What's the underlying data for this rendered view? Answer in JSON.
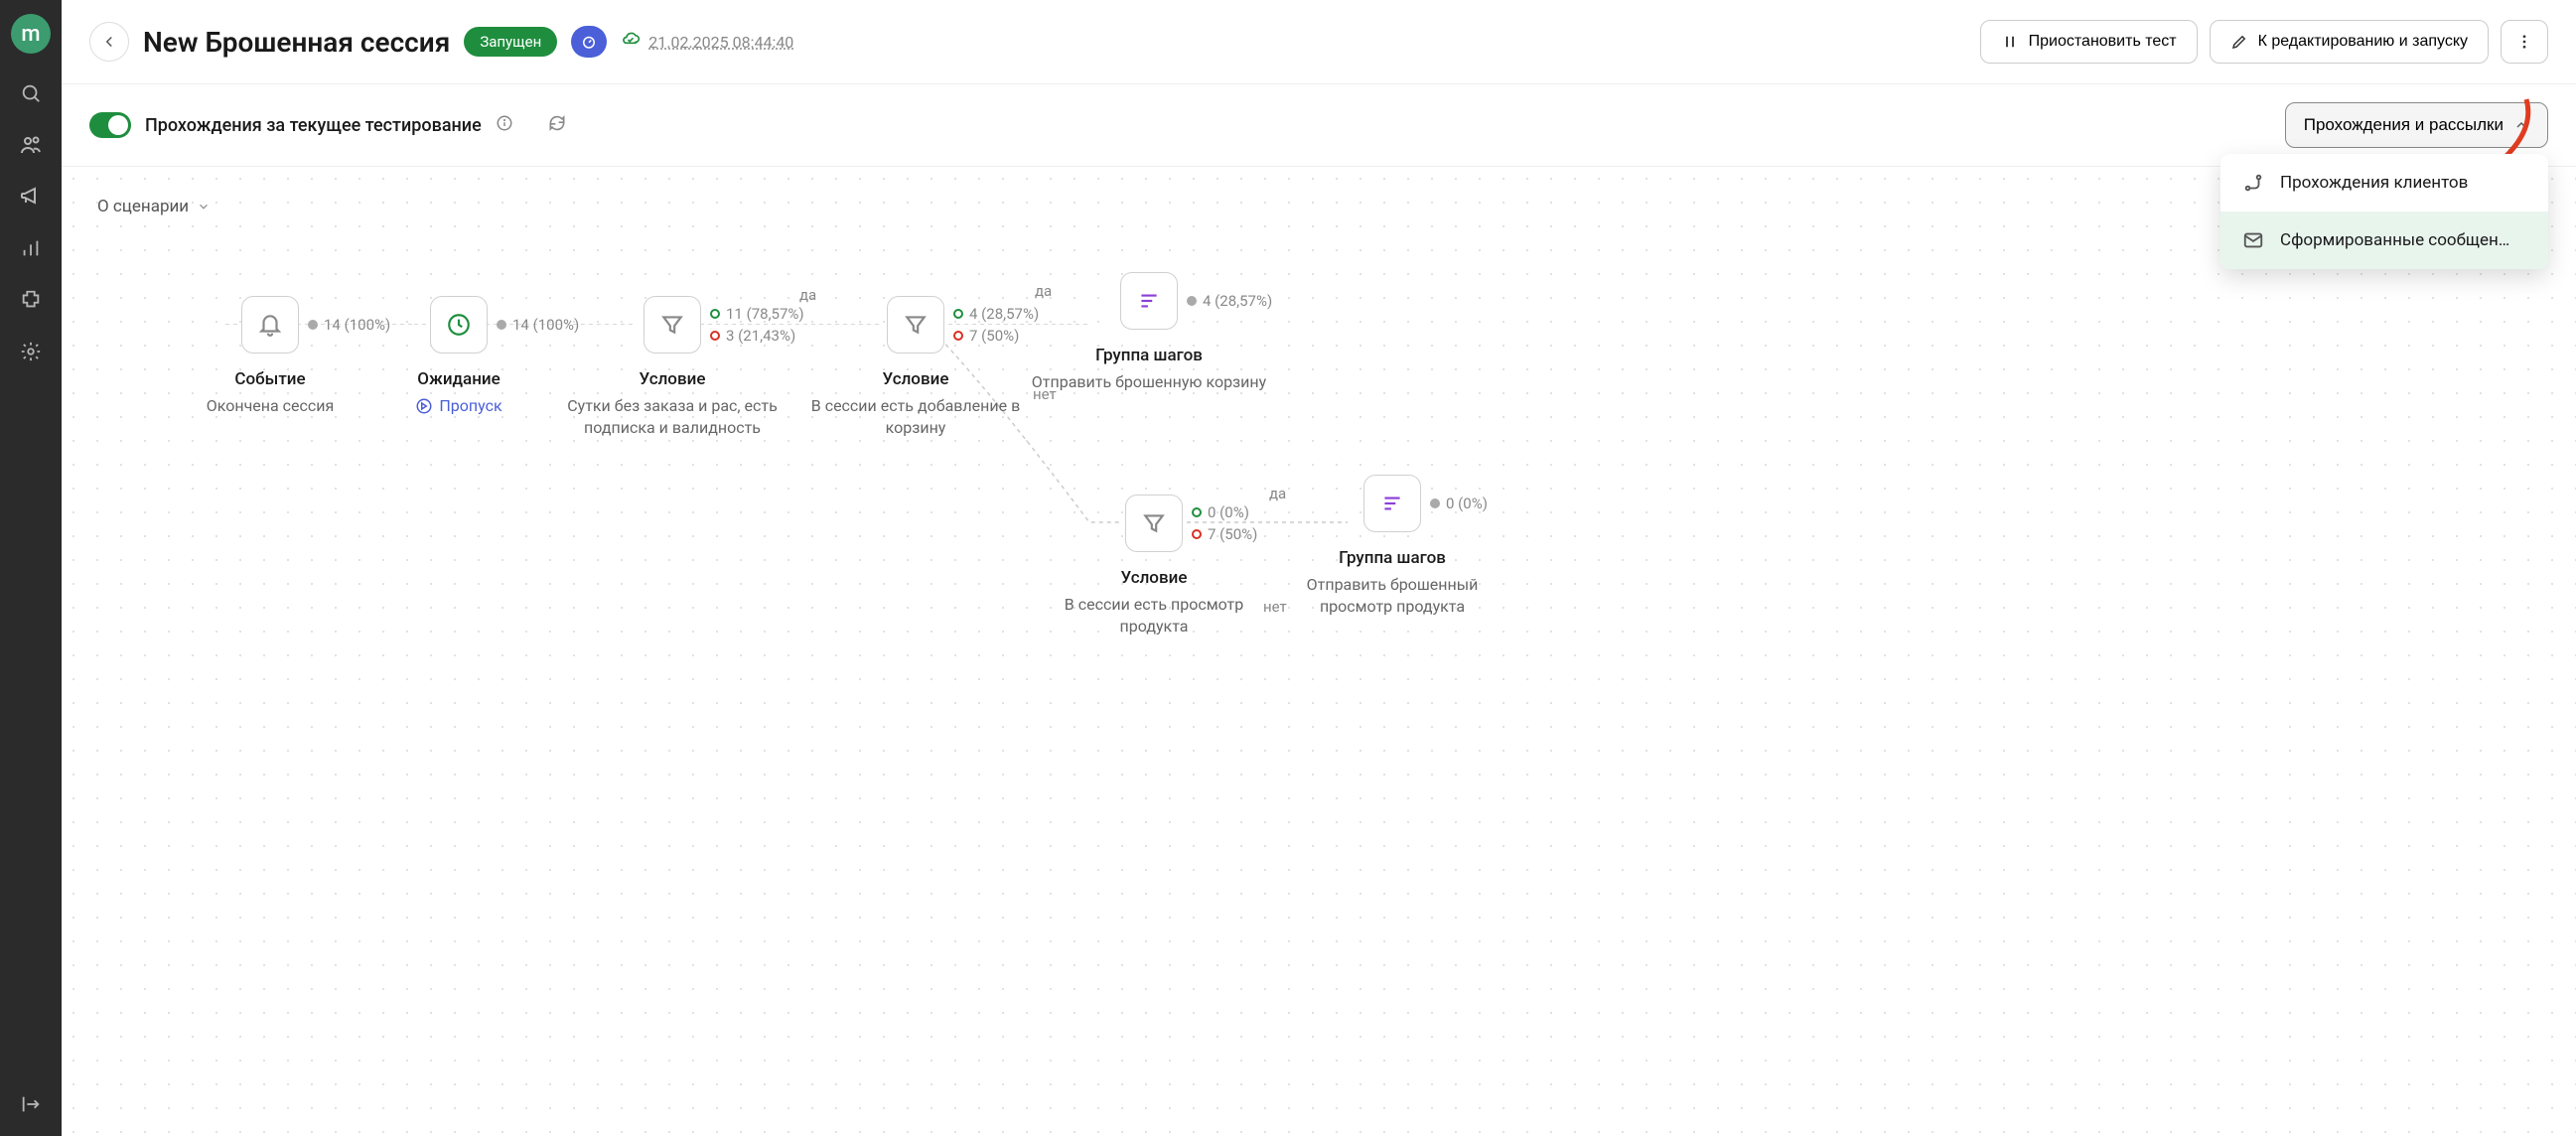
{
  "sidebar": {
    "logo": "m"
  },
  "header": {
    "title": "New Брошенная сессия",
    "status_label": "Запущен",
    "timestamp": "21.02.2025 08:44:40",
    "pause_label": "Приостановить тест",
    "edit_label": "К редактированию и запуску"
  },
  "subheader": {
    "toggle_label": "Прохождения за текущее тестирование",
    "dropdown_label": "Прохождения и рассылки",
    "menu_item1": "Прохождения клиентов",
    "menu_item2": "Сформированные сообщен…"
  },
  "canvas": {
    "scenario_label": "О сценарии"
  },
  "nodes": {
    "n1": {
      "title": "Событие",
      "sub": "Окончена сессия",
      "stat": "14 (100%)"
    },
    "n2": {
      "title": "Ожидание",
      "sub": "Пропуск",
      "stat": "14 (100%)"
    },
    "n3": {
      "title": "Условие",
      "sub": "Сутки без заказа и рас, есть подписка и валидность",
      "stat_yes": "11 (78,57%)",
      "stat_no": "3 (21,43%)"
    },
    "n4": {
      "title": "Условие",
      "sub": "В сессии есть добавление в корзину",
      "stat_yes": "4 (28,57%)",
      "stat_no": "7 (50%)"
    },
    "n5": {
      "title": "Группа шагов",
      "sub": "Отправить брошенную корзину",
      "stat": "4 (28,57%)"
    },
    "n6": {
      "title": "Условие",
      "sub": "В сессии есть просмотр продукта",
      "stat_yes": "0 (0%)",
      "stat_no": "7 (50%)"
    },
    "n7": {
      "title": "Группа шагов",
      "sub": "Отправить брошенный просмотр продукта",
      "stat": "0 (0%)"
    }
  },
  "edge_labels": {
    "yes1": "да",
    "yes2": "да",
    "no2": "нет",
    "yes3": "да",
    "no3": "нет"
  }
}
